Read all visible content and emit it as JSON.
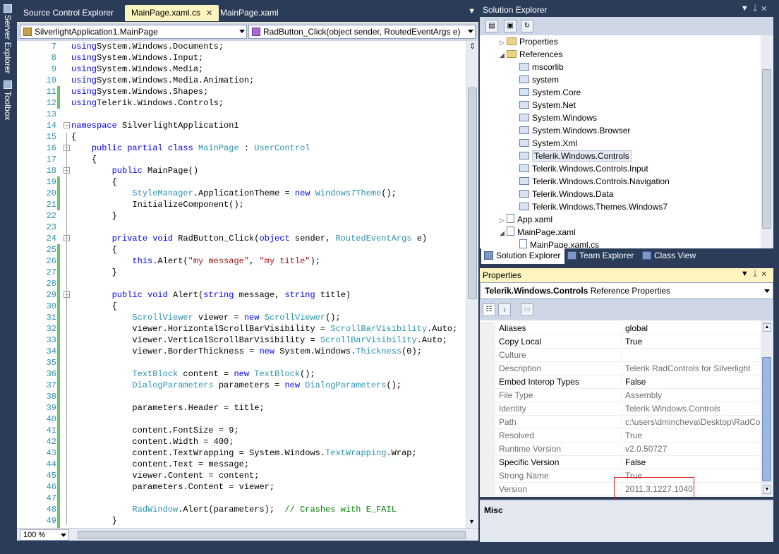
{
  "sidebar": {
    "server_explorer_label": "Server Explorer",
    "toolbox_label": "Toolbox"
  },
  "document_tabs": [
    {
      "label": "Source Control Explorer",
      "active": false
    },
    {
      "label": "MainPage.xaml.cs",
      "active": true
    },
    {
      "label": "MainPage.xaml",
      "active": false
    }
  ],
  "navigation": {
    "type_combo": "SilverlightApplication1.MainPage",
    "member_combo": "RadButton_Click(object sender, RoutedEventArgs e)"
  },
  "code": {
    "line_numbers": [
      "7",
      "8",
      "9",
      "10",
      "11",
      "12",
      "13",
      "14",
      "15",
      "16",
      "17",
      "18",
      "19",
      "20",
      "21",
      "22",
      "23",
      "24",
      "25",
      "26",
      "27",
      "28",
      "29",
      "30",
      "31",
      "32",
      "33",
      "34",
      "35",
      "36",
      "37",
      "38",
      "39",
      "40",
      "41",
      "42",
      "43",
      "44",
      "45",
      "46",
      "47",
      "48",
      "49",
      "50"
    ],
    "changed_lines": [
      "11",
      "12",
      "19",
      "20",
      "21",
      "25",
      "26",
      "27",
      "28",
      "29",
      "30",
      "31",
      "32",
      "33",
      "34",
      "35",
      "36",
      "37",
      "38",
      "39",
      "40",
      "41",
      "42",
      "43",
      "44",
      "45",
      "46",
      "47",
      "48",
      "49",
      "50"
    ],
    "lines": [
      [
        [
          "kw",
          "using"
        ],
        [
          "",
          "System.Windows.Documents;"
        ]
      ],
      [
        [
          "kw",
          "using"
        ],
        [
          "",
          "System.Windows.Input;"
        ]
      ],
      [
        [
          "kw",
          "using"
        ],
        [
          "",
          "System.Windows.Media;"
        ]
      ],
      [
        [
          "kw",
          "using"
        ],
        [
          "",
          "System.Windows.Media.Animation;"
        ]
      ],
      [
        [
          "kw",
          "using"
        ],
        [
          "",
          "System.Windows.Shapes;"
        ]
      ],
      [
        [
          "kw",
          "using"
        ],
        [
          "",
          "Telerik.Windows.Controls;"
        ]
      ],
      [],
      [
        [
          "kw",
          "namespace"
        ],
        [
          "",
          " SilverlightApplication1"
        ]
      ],
      [
        [
          "",
          "{"
        ]
      ],
      [
        [
          "",
          "    "
        ],
        [
          "kw",
          "public partial class"
        ],
        [
          "",
          " "
        ],
        [
          "ty",
          "MainPage"
        ],
        [
          "",
          " : "
        ],
        [
          "ty",
          "UserControl"
        ]
      ],
      [
        [
          "",
          "    {"
        ]
      ],
      [
        [
          "",
          "        "
        ],
        [
          "kw",
          "public"
        ],
        [
          "",
          " MainPage()"
        ]
      ],
      [
        [
          "",
          "        {"
        ]
      ],
      [
        [
          "",
          "            "
        ],
        [
          "ty",
          "StyleManager"
        ],
        [
          "",
          ".ApplicationTheme = "
        ],
        [
          "kw",
          "new"
        ],
        [
          "",
          " "
        ],
        [
          "ty",
          "Windows7Theme"
        ],
        [
          "",
          "();"
        ]
      ],
      [
        [
          "",
          "            InitializeComponent();"
        ]
      ],
      [
        [
          "",
          "        }"
        ]
      ],
      [],
      [
        [
          "",
          "        "
        ],
        [
          "kw",
          "private void"
        ],
        [
          "",
          " RadButton_Click("
        ],
        [
          "kw",
          "object"
        ],
        [
          "",
          " sender, "
        ],
        [
          "ty",
          "RoutedEventArgs"
        ],
        [
          "",
          " e)"
        ]
      ],
      [
        [
          "",
          "        {"
        ]
      ],
      [
        [
          "",
          "            "
        ],
        [
          "kw",
          "this"
        ],
        [
          "",
          ".Alert("
        ],
        [
          "st",
          "\"my message\""
        ],
        [
          "",
          ", "
        ],
        [
          "st",
          "\"my title\""
        ],
        [
          "",
          ");"
        ]
      ],
      [
        [
          "",
          "        }"
        ]
      ],
      [],
      [
        [
          "",
          "        "
        ],
        [
          "kw",
          "public void"
        ],
        [
          "",
          " Alert("
        ],
        [
          "kw",
          "string"
        ],
        [
          "",
          " message, "
        ],
        [
          "kw",
          "string"
        ],
        [
          "",
          " title)"
        ]
      ],
      [
        [
          "",
          "        {"
        ]
      ],
      [
        [
          "",
          "            "
        ],
        [
          "ty",
          "ScrollViewer"
        ],
        [
          "",
          " viewer = "
        ],
        [
          "kw",
          "new"
        ],
        [
          "",
          " "
        ],
        [
          "ty",
          "ScrollViewer"
        ],
        [
          "",
          "();"
        ]
      ],
      [
        [
          "",
          "            viewer.HorizontalScrollBarVisibility = "
        ],
        [
          "ty",
          "ScrollBarVisibility"
        ],
        [
          "",
          ".Auto;"
        ]
      ],
      [
        [
          "",
          "            viewer.VerticalScrollBarVisibility = "
        ],
        [
          "ty",
          "ScrollBarVisibility"
        ],
        [
          "",
          ".Auto;"
        ]
      ],
      [
        [
          "",
          "            viewer.BorderThickness = "
        ],
        [
          "kw",
          "new"
        ],
        [
          "",
          " System.Windows."
        ],
        [
          "ty",
          "Thickness"
        ],
        [
          "",
          "(0);"
        ]
      ],
      [],
      [
        [
          "",
          "            "
        ],
        [
          "ty",
          "TextBlock"
        ],
        [
          "",
          " content = "
        ],
        [
          "kw",
          "new"
        ],
        [
          "",
          " "
        ],
        [
          "ty",
          "TextBlock"
        ],
        [
          "",
          "();"
        ]
      ],
      [
        [
          "",
          "            "
        ],
        [
          "ty",
          "DialogParameters"
        ],
        [
          "",
          " parameters = "
        ],
        [
          "kw",
          "new"
        ],
        [
          "",
          " "
        ],
        [
          "ty",
          "DialogParameters"
        ],
        [
          "",
          "();"
        ]
      ],
      [],
      [
        [
          "",
          "            parameters.Header = title;"
        ]
      ],
      [],
      [
        [
          "",
          "            content.FontSize = 9;"
        ]
      ],
      [
        [
          "",
          "            content.Width = 400;"
        ]
      ],
      [
        [
          "",
          "            content.TextWrapping = System.Windows."
        ],
        [
          "ty",
          "TextWrapping"
        ],
        [
          "",
          ".Wrap;"
        ]
      ],
      [
        [
          "",
          "            content.Text = message;"
        ]
      ],
      [
        [
          "",
          "            viewer.Content = content;"
        ]
      ],
      [
        [
          "",
          "            parameters.Content = viewer;"
        ]
      ],
      [],
      [
        [
          "",
          "            "
        ],
        [
          "ty",
          "RadWindow"
        ],
        [
          "",
          ".Alert(parameters);  "
        ],
        [
          "cm",
          "// Crashes with E_FAIL"
        ]
      ],
      [
        [
          "",
          "        }"
        ]
      ],
      []
    ]
  },
  "editor_footer": {
    "zoom": "100 %"
  },
  "solution_explorer": {
    "title": "Solution Explorer",
    "items": [
      {
        "label": "Properties",
        "indent": 0,
        "kind": "folder",
        "exp": "▷"
      },
      {
        "label": "References",
        "indent": 0,
        "kind": "folder",
        "exp": "◢"
      },
      {
        "label": "mscorlib",
        "indent": 1,
        "kind": "ref",
        "exp": ""
      },
      {
        "label": "system",
        "indent": 1,
        "kind": "ref",
        "exp": ""
      },
      {
        "label": "System.Core",
        "indent": 1,
        "kind": "ref",
        "exp": ""
      },
      {
        "label": "System.Net",
        "indent": 1,
        "kind": "ref",
        "exp": ""
      },
      {
        "label": "System.Windows",
        "indent": 1,
        "kind": "ref",
        "exp": ""
      },
      {
        "label": "System.Windows.Browser",
        "indent": 1,
        "kind": "ref",
        "exp": ""
      },
      {
        "label": "System.Xml",
        "indent": 1,
        "kind": "ref",
        "exp": ""
      },
      {
        "label": "Telerik.Windows.Controls",
        "indent": 1,
        "kind": "ref",
        "exp": "",
        "selected": true
      },
      {
        "label": "Telerik.Windows.Controls.Input",
        "indent": 1,
        "kind": "ref",
        "exp": ""
      },
      {
        "label": "Telerik.Windows.Controls.Navigation",
        "indent": 1,
        "kind": "ref",
        "exp": ""
      },
      {
        "label": "Telerik.Windows.Data",
        "indent": 1,
        "kind": "ref",
        "exp": ""
      },
      {
        "label": "Telerik.Windows.Themes.Windows7",
        "indent": 1,
        "kind": "ref",
        "exp": ""
      },
      {
        "label": "App.xaml",
        "indent": 0,
        "kind": "file",
        "exp": "▷"
      },
      {
        "label": "MainPage.xaml",
        "indent": 0,
        "kind": "file",
        "exp": "◢"
      },
      {
        "label": "MainPage.xaml.cs",
        "indent": 1,
        "kind": "file",
        "exp": ""
      }
    ],
    "tabs": [
      {
        "label": "Solution Explorer",
        "active": true
      },
      {
        "label": "Team Explorer",
        "active": false
      },
      {
        "label": "Class View",
        "active": false
      }
    ]
  },
  "properties": {
    "title": "Properties",
    "object_name": "Telerik.Windows.Controls",
    "object_type": "Reference Properties",
    "rows": [
      {
        "name": "Aliases",
        "value": "global",
        "readonly": false
      },
      {
        "name": "Copy Local",
        "value": "True",
        "readonly": false
      },
      {
        "name": "Culture",
        "value": "",
        "readonly": true
      },
      {
        "name": "Description",
        "value": "Telerik RadControls for Silverlight",
        "readonly": true
      },
      {
        "name": "Embed Interop Types",
        "value": "False",
        "readonly": false
      },
      {
        "name": "File Type",
        "value": "Assembly",
        "readonly": true
      },
      {
        "name": "Identity",
        "value": "Telerik.Windows.Controls",
        "readonly": true
      },
      {
        "name": "Path",
        "value": "c:\\users\\dmincheva\\Desktop\\RadCo",
        "readonly": true
      },
      {
        "name": "Resolved",
        "value": "True",
        "readonly": true
      },
      {
        "name": "Runtime Version",
        "value": "v2.0.50727",
        "readonly": true
      },
      {
        "name": "Specific Version",
        "value": "False",
        "readonly": false
      },
      {
        "name": "Strong Name",
        "value": "True",
        "readonly": true
      },
      {
        "name": "Version",
        "value": "2011.3.1227.1040",
        "readonly": true
      }
    ],
    "description_title": "Misc"
  },
  "colors": {
    "chrome": "#2b3c59",
    "active_tab": "#fdf4bf",
    "keyword": "#0000ff",
    "type": "#2b91af",
    "string": "#a31515",
    "comment": "#008000",
    "highlight_box": "#e02020"
  }
}
